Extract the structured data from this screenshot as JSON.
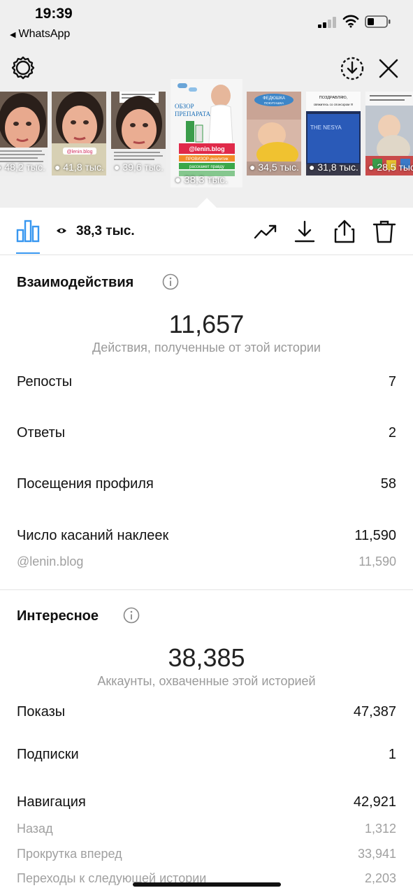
{
  "status": {
    "time": "19:39",
    "back_app": "WhatsApp",
    "back_arrow": "◀"
  },
  "stories": [
    {
      "views": "48,2 тыс."
    },
    {
      "views": "41,8 тыс."
    },
    {
      "views": "39,6 тыс."
    },
    {
      "views": "38,3 тыс.",
      "selected": true,
      "text": {
        "line1": "ОБЗОР",
        "line2": "ПРЕПАРАТА",
        "handle": "@lenin.blog",
        "tag": "ПРОВИЗОР-аналитик",
        "note": "расскажет правду"
      }
    },
    {
      "views": "34,5 тыс.",
      "text": {
        "line1": "ФЕДЮШКА",
        "line2": "ПОКУПАШКА"
      }
    },
    {
      "views": "31,8 тыс.",
      "text": {
        "line1": "ПОЗДРАВЛЯЮ,",
        "line2": "свяжитесь со спонсором !!!",
        "brand": "THE NESYA"
      }
    },
    {
      "views": "28,5 тыс."
    }
  ],
  "action_bar": {
    "views": "38,3 тыс.",
    "accent": "#3897f0"
  },
  "interactions": {
    "title": "Взаимодействия",
    "total": "11,657",
    "caption": "Действия, полученные от этой истории",
    "rows": [
      {
        "label": "Репосты",
        "value": "7"
      },
      {
        "label": "Ответы",
        "value": "2"
      },
      {
        "label": "Посещения профиля",
        "value": "58"
      },
      {
        "label": "Число касаний наклеек",
        "value": "11,590"
      }
    ],
    "sticker_sub": {
      "label": "@lenin.blog",
      "value": "11,590"
    }
  },
  "discovery": {
    "title": "Интересное",
    "total": "38,385",
    "caption": "Аккаунты, охваченные этой историей",
    "rows": [
      {
        "label": "Показы",
        "value": "47,387"
      },
      {
        "label": "Подписки",
        "value": "1"
      },
      {
        "label": "Навигация",
        "value": "42,921"
      }
    ],
    "navigation_sub": [
      {
        "label": "Назад",
        "value": "1,312"
      },
      {
        "label": "Прокрутка вперед",
        "value": "33,941"
      },
      {
        "label": "Переходы к следующей истории",
        "value": "2,203"
      }
    ]
  }
}
